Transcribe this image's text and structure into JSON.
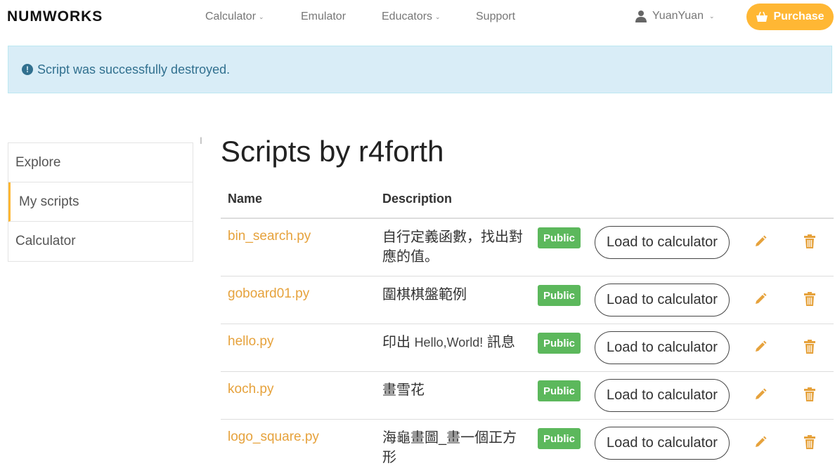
{
  "header": {
    "logo": "NUMWORKS",
    "nav": [
      {
        "label": "Calculator",
        "dropdown": true
      },
      {
        "label": "Emulator",
        "dropdown": false
      },
      {
        "label": "Educators",
        "dropdown": true
      },
      {
        "label": "Support",
        "dropdown": false
      }
    ],
    "user": "YuanYuan",
    "purchase_label": "Purchase"
  },
  "alert": {
    "message": "Script was successfully destroyed."
  },
  "sidebar": {
    "items": [
      {
        "label": "Explore",
        "active": false
      },
      {
        "label": "My scripts",
        "active": true
      },
      {
        "label": "Calculator",
        "active": false
      }
    ]
  },
  "main": {
    "title": "Scripts by r4forth",
    "columns": {
      "name": "Name",
      "description": "Description"
    },
    "rows": [
      {
        "name": "bin_search.py",
        "description": "自行定義函數，找出對應的值。",
        "visibility": "Public",
        "load_label": "Load to calculator"
      },
      {
        "name": "goboard01.py",
        "description": "圍棋棋盤範例",
        "visibility": "Public",
        "load_label": "Load to calculator"
      },
      {
        "name": "hello.py",
        "description_parts": [
          "印出 ",
          "Hello,World!",
          " 訊息"
        ],
        "visibility": "Public",
        "load_label": "Load to calculator"
      },
      {
        "name": "koch.py",
        "description": "畫雪花",
        "visibility": "Public",
        "load_label": "Load to calculator"
      },
      {
        "name": "logo_square.py",
        "description": "海龜畫圖_畫一個正方形",
        "visibility": "Public",
        "load_label": "Load to calculator"
      }
    ]
  },
  "colors": {
    "accent": "#ffb734",
    "link": "#e6a23c",
    "badge": "#5cb85c",
    "alert_bg": "#d9edf7",
    "alert_text": "#31708f"
  },
  "icons": {
    "user": "user-icon",
    "purchase": "basket-icon",
    "alert": "exclamation-circle-icon",
    "edit": "pencil-icon",
    "delete": "trash-icon",
    "dropdown": "chevron-down-icon"
  }
}
